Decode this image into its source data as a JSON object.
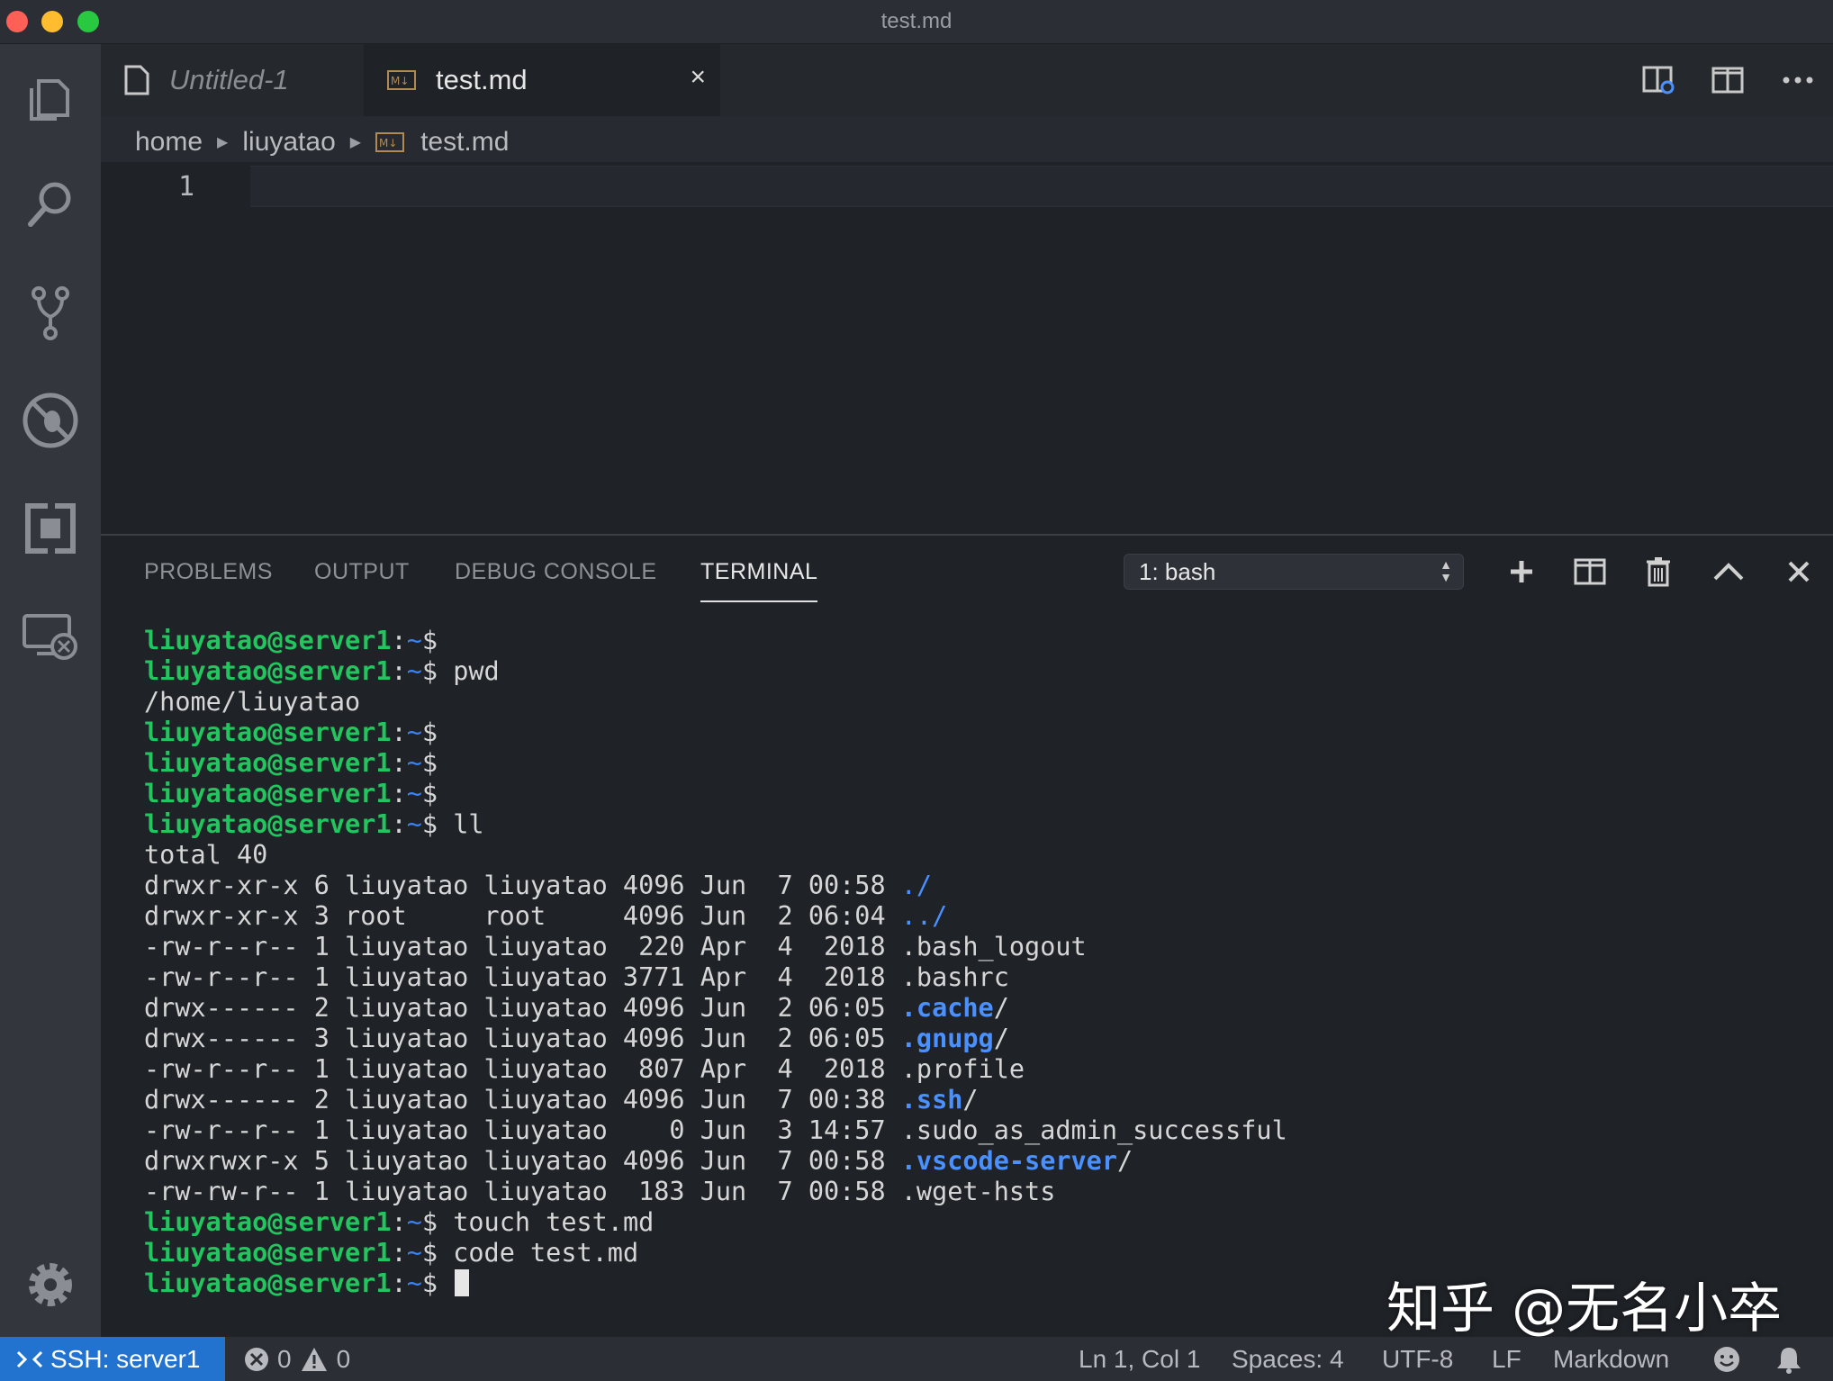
{
  "window": {
    "title": "test.md"
  },
  "activity_bar": {
    "items": [
      "files-icon",
      "search-icon",
      "source-control-icon",
      "debug-icon",
      "extensions-icon",
      "remote-explorer-icon"
    ],
    "bottom": "settings-gear-icon"
  },
  "tabs": [
    {
      "label": "Untitled-1",
      "icon": "file-icon",
      "active": false
    },
    {
      "label": "test.md",
      "icon": "markdown-icon",
      "active": true,
      "close": "×"
    }
  ],
  "breadcrumb": [
    "home",
    "liuyatao",
    "test.md"
  ],
  "editor": {
    "line_number": "1"
  },
  "panel": {
    "tabs": [
      "PROBLEMS",
      "OUTPUT",
      "DEBUG CONSOLE",
      "TERMINAL"
    ],
    "active_tab": "TERMINAL",
    "terminal_select": "1: bash"
  },
  "terminal": {
    "prompt_user": "liuyatao@server1",
    "prompt_tilde": "~",
    "lines": [
      {
        "type": "prompt",
        "cmd": ""
      },
      {
        "type": "prompt",
        "cmd": "pwd"
      },
      {
        "type": "out",
        "text": "/home/liuyatao"
      },
      {
        "type": "prompt",
        "cmd": ""
      },
      {
        "type": "prompt",
        "cmd": ""
      },
      {
        "type": "prompt",
        "cmd": ""
      },
      {
        "type": "prompt",
        "cmd": "ll"
      },
      {
        "type": "out",
        "text": "total 40"
      },
      {
        "type": "ls",
        "pre": "drwxr-xr-x 6 liuyatao liuyatao 4096 Jun  7 00:58 ",
        "name": "./",
        "style": "dotdir"
      },
      {
        "type": "ls",
        "pre": "drwxr-xr-x 3 root     root     4096 Jun  2 06:04 ",
        "name": "../",
        "style": "dotdir"
      },
      {
        "type": "ls",
        "pre": "-rw-r--r-- 1 liuyatao liuyatao  220 Apr  4  2018 ",
        "name": ".bash_logout",
        "style": "plain"
      },
      {
        "type": "ls",
        "pre": "-rw-r--r-- 1 liuyatao liuyatao 3771 Apr  4  2018 ",
        "name": ".bashrc",
        "style": "plain"
      },
      {
        "type": "ls",
        "pre": "drwx------ 2 liuyatao liuyatao 4096 Jun  2 06:05 ",
        "name": ".cache",
        "suffix": "/",
        "style": "dir"
      },
      {
        "type": "ls",
        "pre": "drwx------ 3 liuyatao liuyatao 4096 Jun  2 06:05 ",
        "name": ".gnupg",
        "suffix": "/",
        "style": "dir"
      },
      {
        "type": "ls",
        "pre": "-rw-r--r-- 1 liuyatao liuyatao  807 Apr  4  2018 ",
        "name": ".profile",
        "style": "plain"
      },
      {
        "type": "ls",
        "pre": "drwx------ 2 liuyatao liuyatao 4096 Jun  7 00:38 ",
        "name": ".ssh",
        "suffix": "/",
        "style": "dir"
      },
      {
        "type": "ls",
        "pre": "-rw-r--r-- 1 liuyatao liuyatao    0 Jun  3 14:57 ",
        "name": ".sudo_as_admin_successful",
        "style": "plain"
      },
      {
        "type": "ls",
        "pre": "drwxrwxr-x 5 liuyatao liuyatao 4096 Jun  7 00:58 ",
        "name": ".vscode-server",
        "suffix": "/",
        "style": "dir"
      },
      {
        "type": "ls",
        "pre": "-rw-rw-r-- 1 liuyatao liuyatao  183 Jun  7 00:58 ",
        "name": ".wget-hsts",
        "style": "plain"
      },
      {
        "type": "prompt",
        "cmd": "touch test.md"
      },
      {
        "type": "prompt",
        "cmd": "code test.md"
      },
      {
        "type": "prompt",
        "cmd": "",
        "cursor": true
      }
    ]
  },
  "watermark": "知乎 @无名小卒",
  "status_bar": {
    "remote": "SSH: server1",
    "errors": "0",
    "warnings": "0",
    "position": "Ln 1, Col 1",
    "spaces": "Spaces: 4",
    "encoding": "UTF-8",
    "eol": "LF",
    "language": "Markdown"
  },
  "colors": {
    "accent": "#2272cf",
    "prompt_green": "#22c55e",
    "dir_blue": "#4a90ff"
  }
}
